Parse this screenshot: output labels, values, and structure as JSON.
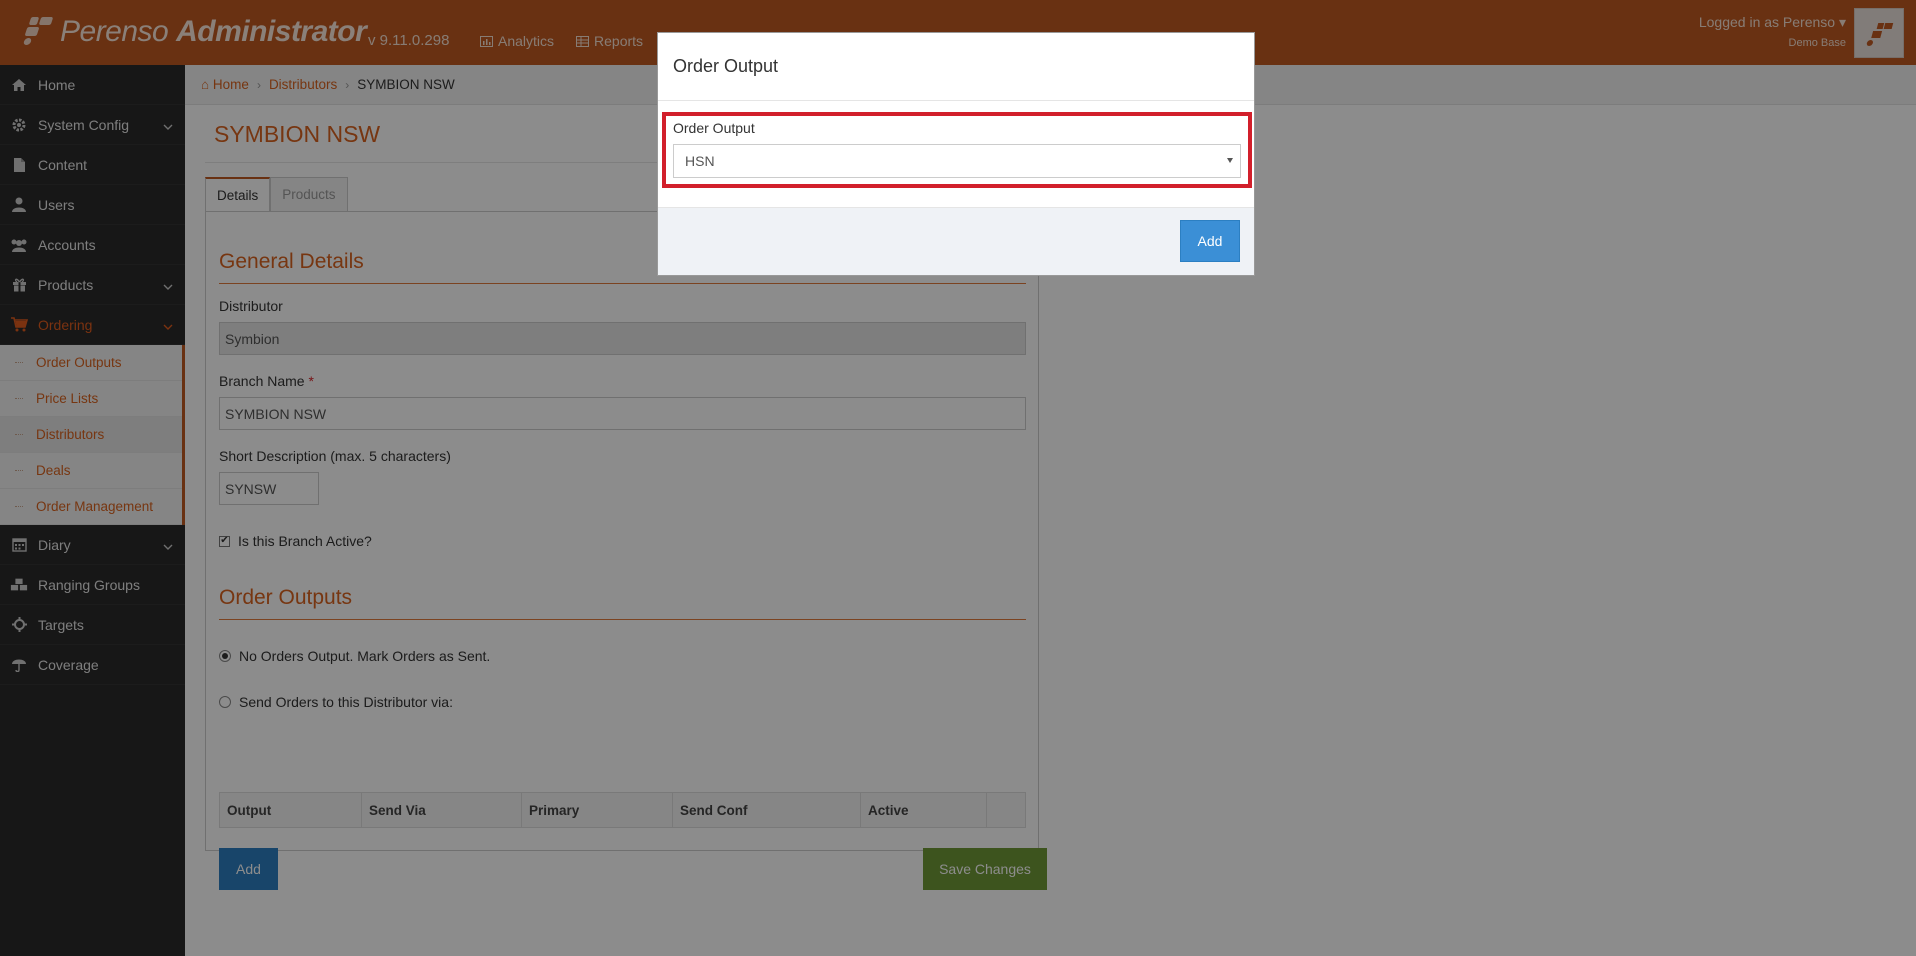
{
  "topbar": {
    "brand_prefix": "Perenso",
    "brand_suffix": "Administrator",
    "version": "v 9.11.0.298",
    "nav": [
      {
        "label": "Analytics",
        "icon": "bar-chart-icon"
      },
      {
        "label": "Reports",
        "icon": "table-icon"
      }
    ],
    "logged_in": "Logged in as Perenso",
    "base": "Demo Base"
  },
  "sidebar": {
    "items": [
      {
        "label": "Home",
        "icon": "home-icon"
      },
      {
        "label": "System Config",
        "icon": "gear-icon"
      },
      {
        "label": "Content",
        "icon": "document-icon"
      },
      {
        "label": "Users",
        "icon": "user-icon"
      },
      {
        "label": "Accounts",
        "icon": "group-icon"
      },
      {
        "label": "Products",
        "icon": "gift-icon"
      },
      {
        "label": "Ordering",
        "icon": "cart-icon"
      },
      {
        "label": "Diary",
        "icon": "calendar-icon"
      },
      {
        "label": "Ranging Groups",
        "icon": "cubes-icon"
      },
      {
        "label": "Targets",
        "icon": "crosshair-icon"
      },
      {
        "label": "Coverage",
        "icon": "umbrella-icon"
      }
    ],
    "ordering_sub": [
      {
        "label": "Order Outputs"
      },
      {
        "label": "Price Lists"
      },
      {
        "label": "Distributors"
      },
      {
        "label": "Deals"
      },
      {
        "label": "Order Management"
      }
    ]
  },
  "breadcrumb": {
    "home": "Home",
    "distributors": "Distributors",
    "current": "SYMBION NSW"
  },
  "page": {
    "title": "SYMBION NSW",
    "tabs": [
      "Details",
      "Products"
    ]
  },
  "form": {
    "general_title": "General Details",
    "distributor_label": "Distributor",
    "distributor_value": "Symbion",
    "branch_label": "Branch Name",
    "required_mark": "*",
    "branch_value": "SYMBION NSW",
    "short_label": "Short Description (max. 5 characters)",
    "short_value": "SYNSW",
    "active_label": "Is this Branch Active?",
    "outputs_title": "Order Outputs",
    "radio_none": "No Orders Output. Mark Orders as Sent.",
    "radio_send": "Send Orders to this Distributor via:",
    "table_headers": [
      "Output",
      "Send Via",
      "Primary",
      "Send Conf",
      "Active",
      ""
    ],
    "add_label": "Add",
    "save_label": "Save Changes"
  },
  "modal": {
    "title": "Order Output",
    "field_label": "Order Output",
    "selected": "HSN",
    "add_label": "Add"
  },
  "colors": {
    "brand": "#c05a22",
    "accent": "#d9631f",
    "primary_button": "#2c7fc2",
    "success_button": "#6f9a37",
    "highlight": "#d21f2b"
  }
}
